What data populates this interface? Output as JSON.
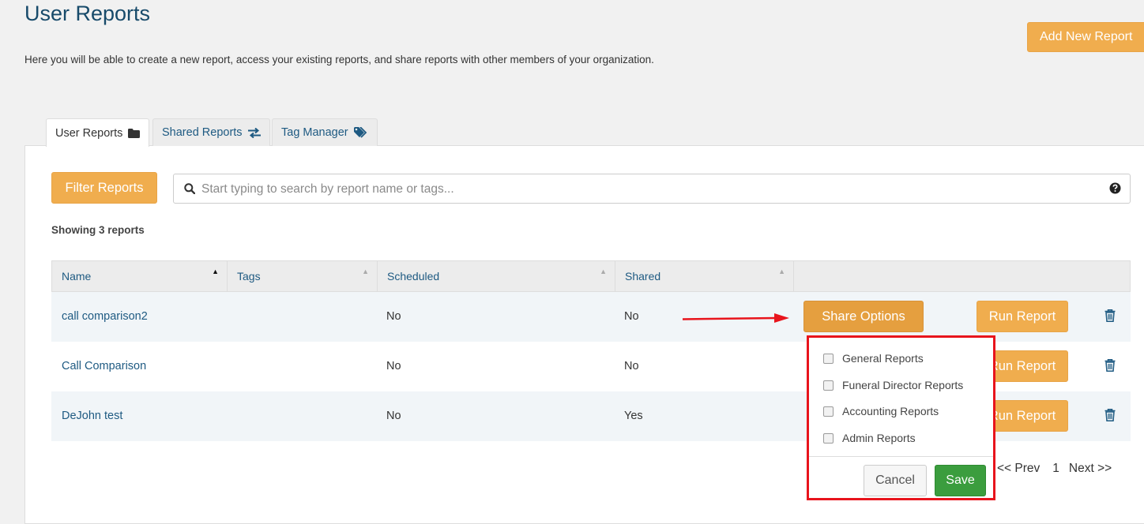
{
  "header": {
    "title": "User Reports",
    "intro": "Here you will be able to create a new report, access your existing reports, and share reports with other members of your organization.",
    "add_new_label": "Add New Report"
  },
  "tabs": [
    {
      "label": "User Reports",
      "icon": "folder-icon",
      "active": true
    },
    {
      "label": "Shared Reports",
      "icon": "exchange-icon",
      "active": false
    },
    {
      "label": "Tag Manager",
      "icon": "tags-icon",
      "active": false
    }
  ],
  "toolbar": {
    "filter_label": "Filter Reports",
    "search_placeholder": "Start typing to search by report name or tags..."
  },
  "summary": "Showing 3 reports",
  "table": {
    "columns": [
      "Name",
      "Tags",
      "Scheduled",
      "Shared"
    ],
    "rows": [
      {
        "name": "call comparison2",
        "tags": "",
        "scheduled": "No",
        "shared": "No"
      },
      {
        "name": "Call Comparison",
        "tags": "",
        "scheduled": "No",
        "shared": "No"
      },
      {
        "name": "DeJohn test",
        "tags": "",
        "scheduled": "No",
        "shared": "Yes"
      }
    ],
    "run_label": "Run Report",
    "share_label": "Share Options"
  },
  "share_menu": {
    "options": [
      "General Reports",
      "Funeral Director Reports",
      "Accounting Reports",
      "Admin Reports"
    ],
    "cancel_label": "Cancel",
    "save_label": "Save"
  },
  "pager": {
    "prev": "<< Prev",
    "page": "1",
    "next": "Next >>"
  },
  "colors": {
    "accent_orange": "#f0ad4e",
    "save_green": "#3b9d3e",
    "highlight_red": "#e8141c",
    "link_blue": "#1e5a82"
  }
}
